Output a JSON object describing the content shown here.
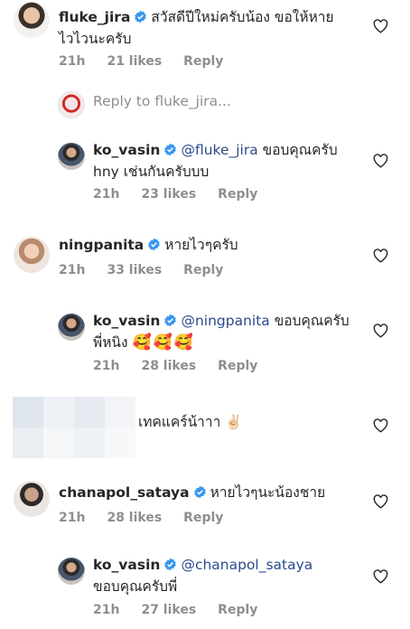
{
  "comments": [
    {
      "username": "fluke_jira",
      "text_line1": "สวัสดีปีใหม่ครับน้อง ขอให้หาย",
      "text_line2": "ไวไวนะครับ",
      "time": "21h",
      "likes": "21 likes",
      "reply": "Reply"
    },
    {
      "username": "ko_vasin",
      "mention": "@fluke_jira",
      "text_rest": " ขอบคุณครับ",
      "text_line2": "hny เช่นกันครับบบ",
      "time": "21h",
      "likes": "23 likes",
      "reply": "Reply"
    },
    {
      "username": "ningpanita",
      "text_line1": "หายไวๆครับ",
      "time": "21h",
      "likes": "33 likes",
      "reply": "Reply"
    },
    {
      "username": "ko_vasin",
      "mention": "@ningpanita",
      "text_rest": " ขอบคุณครับ",
      "text_line2": "พี่หนิง",
      "emojis": "🥰🥰🥰",
      "time": "21h",
      "likes": "28 likes",
      "reply": "Reply"
    },
    {
      "text_line1": "เทคแคร์น้าาา ✌🏻"
    },
    {
      "username": "chanapol_sataya",
      "text_line1": "หายไวๆนะน้องชาย",
      "time": "21h",
      "likes": "28 likes",
      "reply": "Reply"
    },
    {
      "username": "ko_vasin",
      "mention": "@chanapol_sataya",
      "text_line2": "ขอบคุณครับพี่",
      "time": "21h",
      "likes": "27 likes",
      "reply": "Reply"
    }
  ],
  "reply_to_label": "Reply to fluke_jira..."
}
